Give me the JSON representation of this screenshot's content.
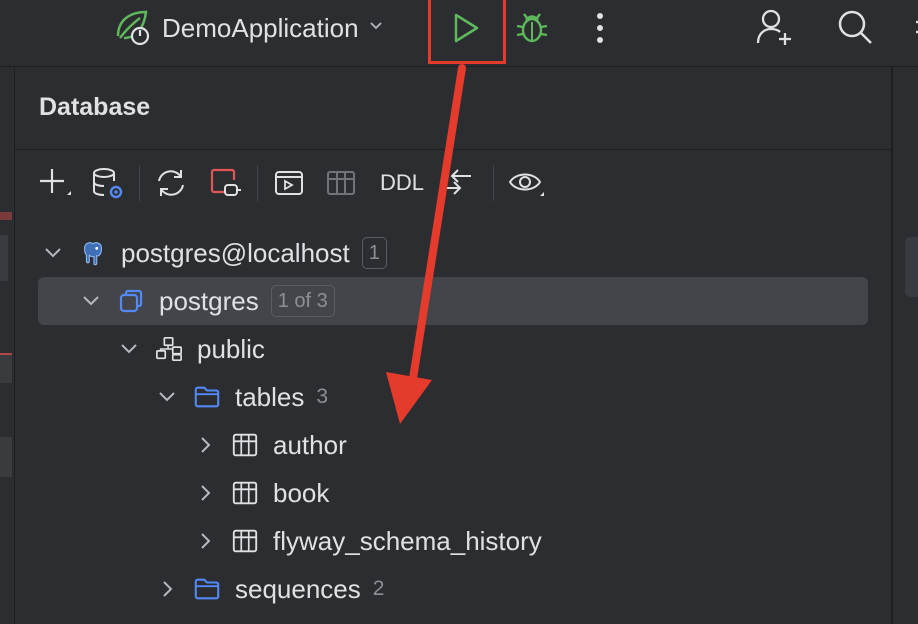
{
  "toolbar": {
    "run_config": "DemoApplication",
    "icons": [
      "spring-run-config-icon",
      "chevron-down-icon",
      "run-icon",
      "debug-icon",
      "more-vertical-icon",
      "add-user-icon",
      "search-icon"
    ]
  },
  "annotation": {
    "color": "#e53b2c",
    "highlighted": "run-button"
  },
  "panel": {
    "title": "Database",
    "toolbar": {
      "items": [
        "add-icon",
        "data-source-properties-icon",
        "refresh-icon",
        "disconnect-icon",
        "query-console-icon",
        "table-view-icon",
        "DDL",
        "compare-icon",
        "view-options-icon"
      ],
      "ddl_label": "DDL"
    },
    "tree": {
      "connection": {
        "label": "postgres@localhost",
        "badge": "1"
      },
      "database": {
        "label": "postgres",
        "badge": "1 of 3"
      },
      "schema": {
        "label": "public"
      },
      "tables": {
        "label": "tables",
        "count": "3"
      },
      "table_items": [
        {
          "label": "author"
        },
        {
          "label": "book"
        },
        {
          "label": "flyway_schema_history"
        }
      ],
      "sequences": {
        "label": "sequences",
        "count": "2"
      }
    }
  },
  "colors": {
    "background": "#1e1f22",
    "panel": "#2b2d30",
    "selection": "#43454a",
    "run_green": "#5fb85c",
    "folder_blue": "#548af7",
    "accent_red": "#e53b2c"
  }
}
